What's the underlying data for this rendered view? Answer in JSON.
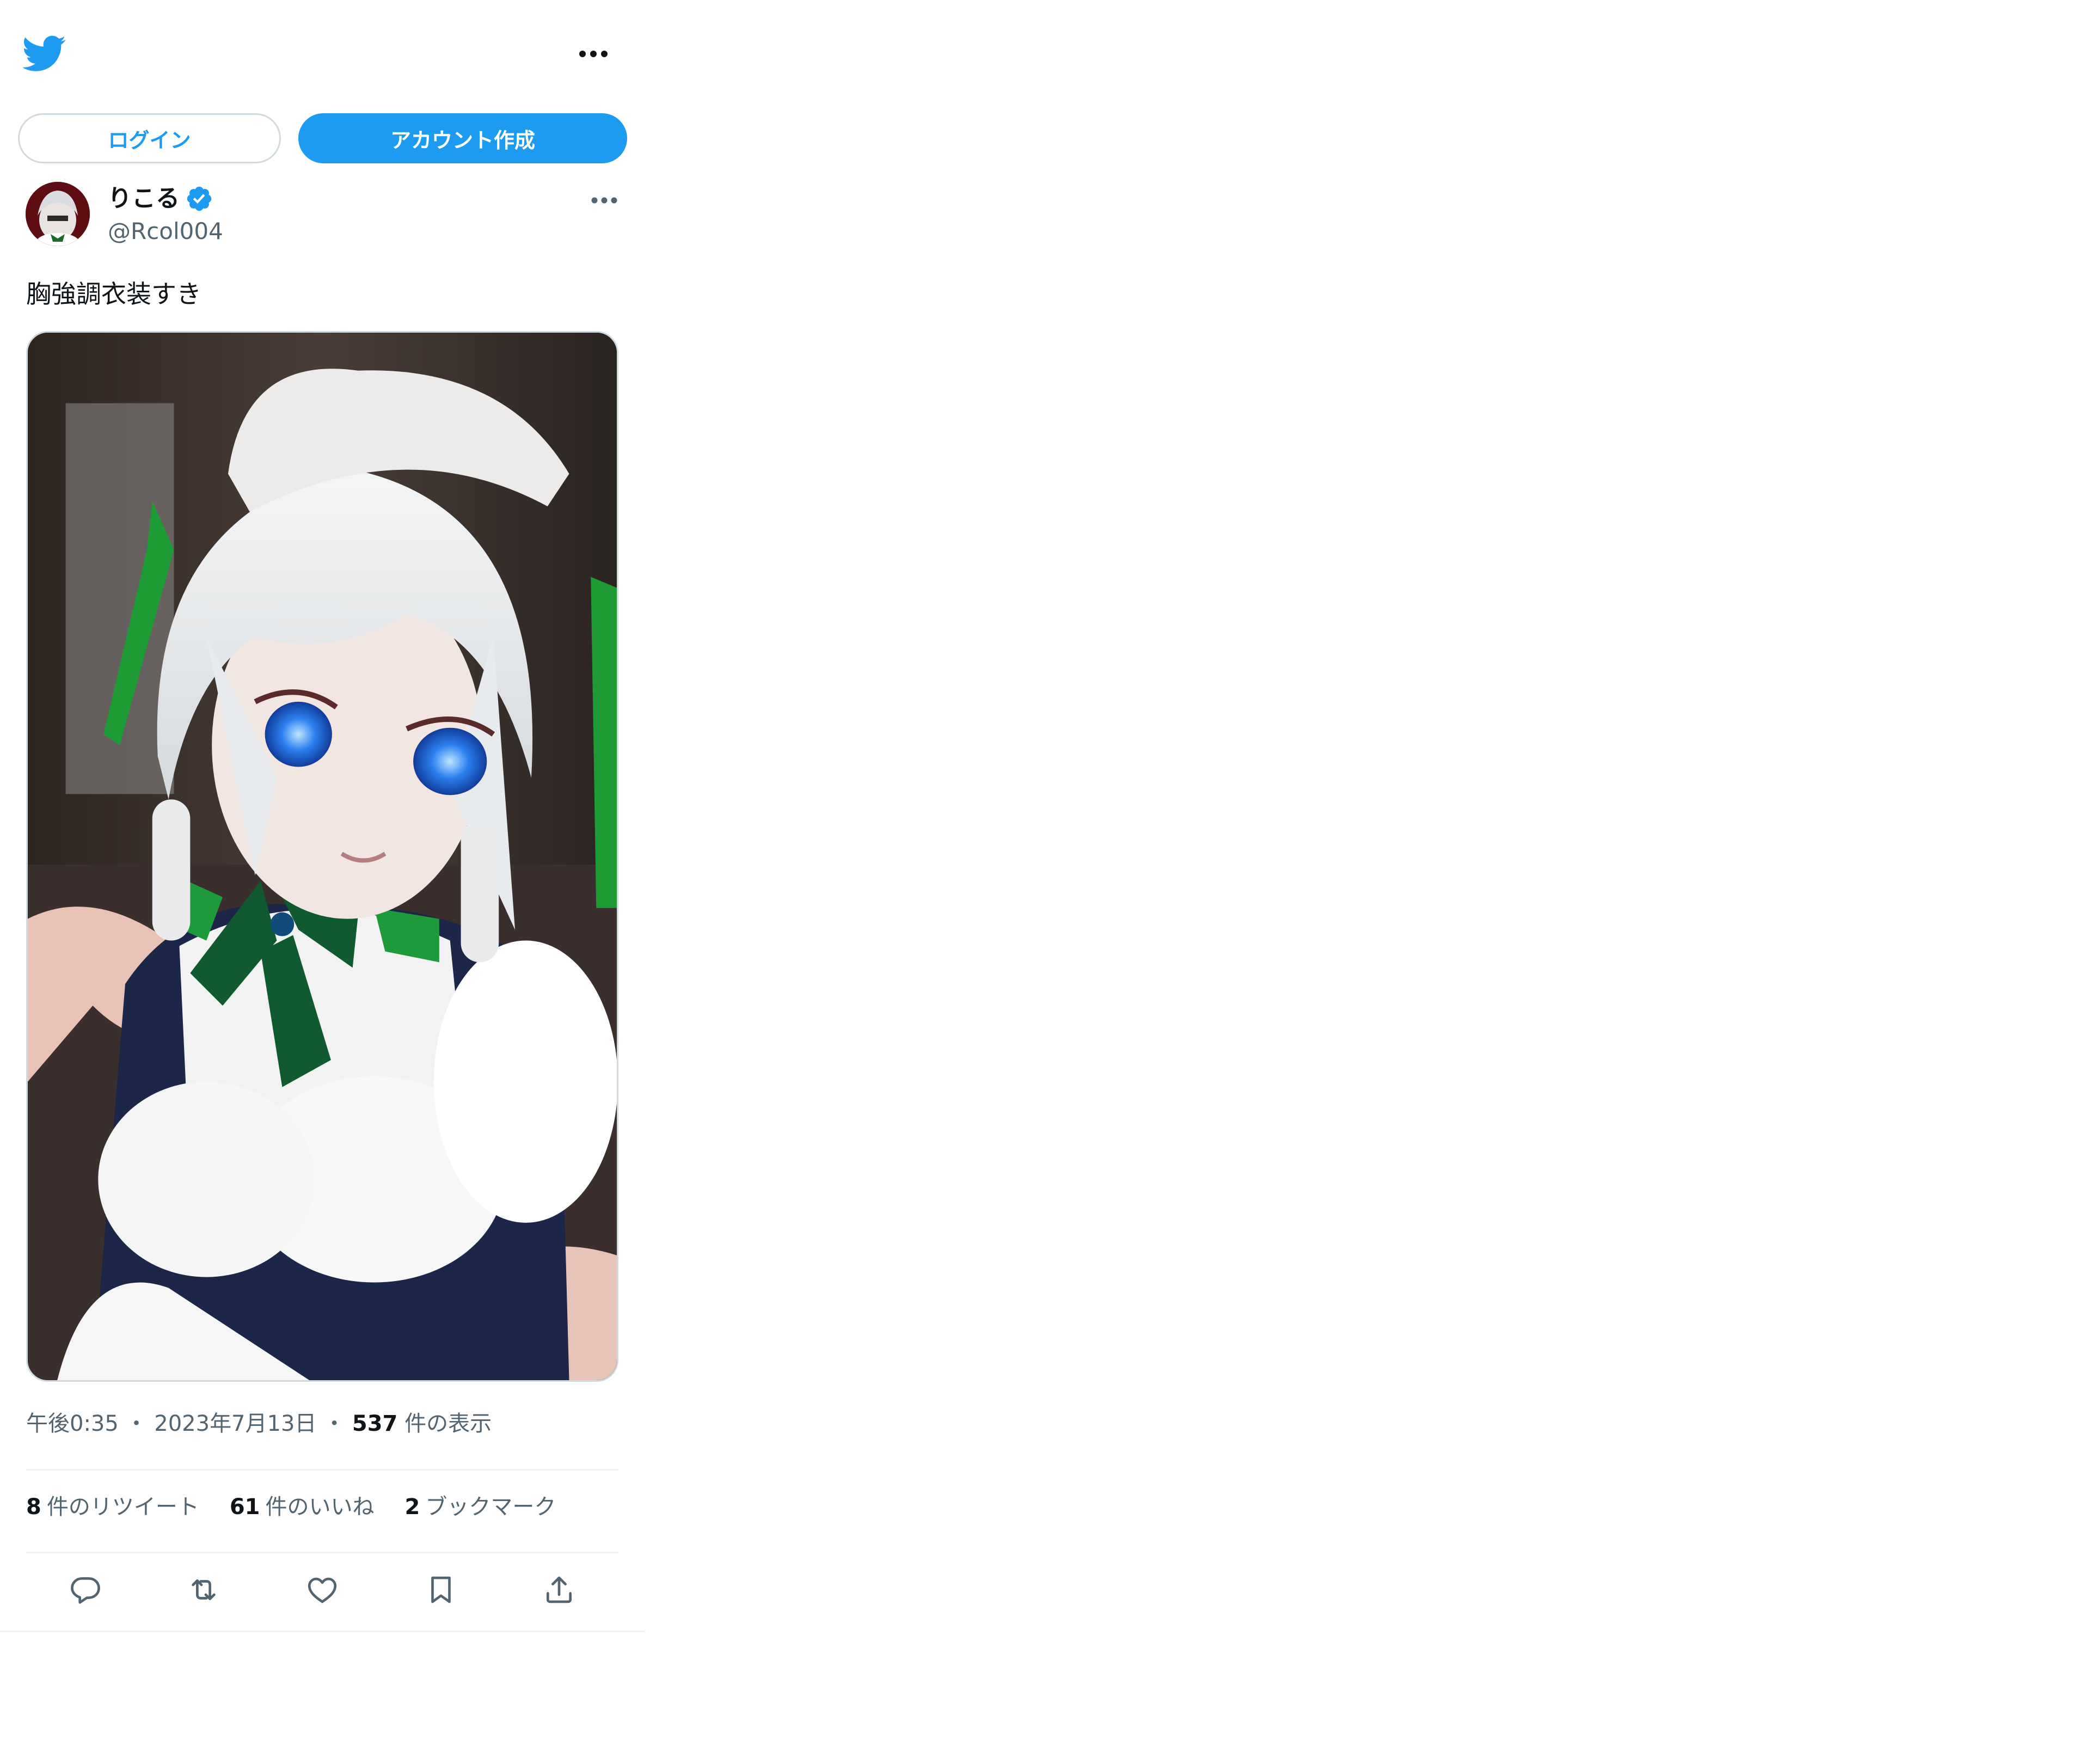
{
  "header": {
    "logo_icon": "twitter-bird-icon",
    "more_icon": "more-horizontal-icon",
    "brand_color": "#1d9bf0"
  },
  "auth": {
    "login_label": "ログイン",
    "signup_label": "アカウント作成"
  },
  "tweet": {
    "author": {
      "display_name": "りこる",
      "handle": "@Rcol004",
      "verified": true
    },
    "text": "胸強調衣装すき",
    "time": "午後0:35",
    "date": "2023年7月13日",
    "separator": "・",
    "views_count": "537",
    "views_label": "件の表示",
    "stats": {
      "retweets_count": "8",
      "retweets_label": "件のリツイート",
      "likes_count": "61",
      "likes_label": "件のいいね",
      "bookmarks_count": "2",
      "bookmarks_label": "ブックマーク"
    },
    "actions": [
      "reply-icon",
      "retweet-icon",
      "like-icon",
      "bookmark-icon",
      "share-icon"
    ]
  }
}
